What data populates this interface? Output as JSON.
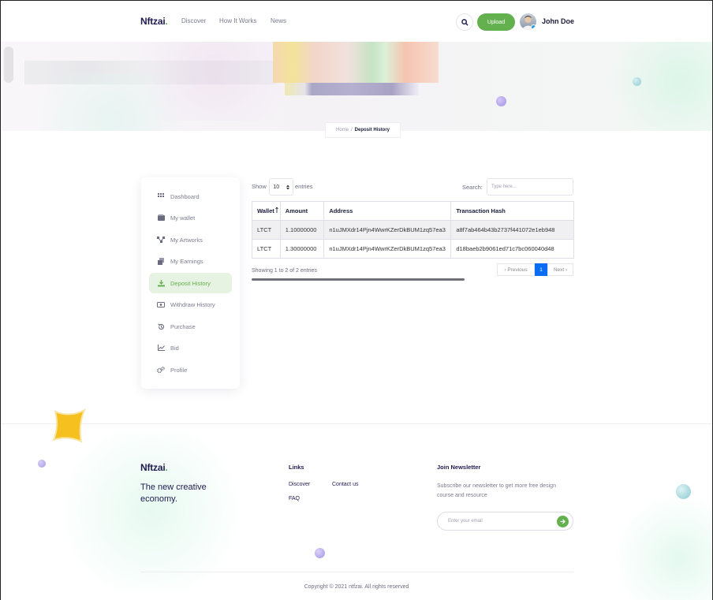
{
  "brand": {
    "name": "Nftzai",
    "dot": ".",
    "accent": "#63b04f",
    "navy": "#1d1a4e"
  },
  "nav": {
    "items": [
      "Discover",
      "How It Works",
      "News"
    ],
    "upload_label": "Upload",
    "user_name": "John Doe"
  },
  "breadcrumb": {
    "home": "Home",
    "sep": "/",
    "current": "Deposit History"
  },
  "sidebar": {
    "items": [
      {
        "label": "Dashboard",
        "icon": "grid-icon"
      },
      {
        "label": "My wallet",
        "icon": "wallet-icon"
      },
      {
        "label": "My Artworks",
        "icon": "network-icon"
      },
      {
        "label": "My Earnings",
        "icon": "stack-icon"
      },
      {
        "label": "Deposit History",
        "icon": "deposit-icon",
        "active": true
      },
      {
        "label": "Withdraw History",
        "icon": "card-icon"
      },
      {
        "label": "Purchase",
        "icon": "history-icon"
      },
      {
        "label": "Bid",
        "icon": "chart-icon"
      },
      {
        "label": "Profile",
        "icon": "gears-icon"
      }
    ]
  },
  "table_tools": {
    "show": "Show",
    "entries": "entries",
    "page_size": "10",
    "search_label": "Search:",
    "search_placeholder": "Type here..."
  },
  "table": {
    "columns": [
      "Wallet",
      "Amount",
      "Address",
      "Transaction Hash"
    ],
    "rows": [
      [
        "LTCT",
        "1.10000000",
        "n1uJMXdr14Pjn4WwrKZerDkBUM1zq57ea3",
        "a8f7ab464b43b2737f441072e1eb948"
      ],
      [
        "LTCT",
        "1.30000000",
        "n1uJMXdr14Pjn4WwrKZerDkBUM1zq57ea3",
        "d18baeb2b9061ed71c7bc060040d48"
      ]
    ]
  },
  "pagination": {
    "info": "Showing 1 to 2 of 2 entries",
    "previous": "‹ Previous",
    "page": "1",
    "next": "Next ›"
  },
  "footer": {
    "tagline": "The new creative economy.",
    "links_title": "Links",
    "links": [
      "Discover",
      "Contact us",
      "FAQ"
    ],
    "newsletter_title": "Join Newsletter",
    "newsletter_desc": "Subscribe our newsletter to get more free design course and resource",
    "email_placeholder": "Enter your email",
    "copyright": "Copyright © 2021 ntfzai. All rights reserved"
  }
}
